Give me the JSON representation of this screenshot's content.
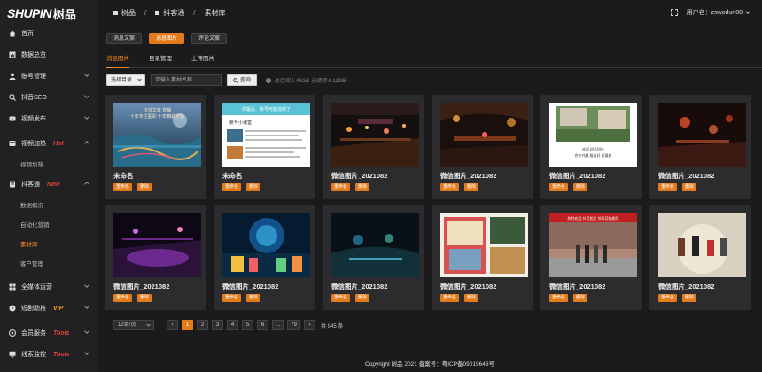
{
  "logo": {
    "en": "SHUPIN",
    "cn": "树品"
  },
  "sidebar": {
    "items": [
      {
        "label": "首页",
        "icon": "home-icon"
      },
      {
        "label": "数据总览",
        "icon": "chart-icon"
      },
      {
        "label": "账号管理",
        "icon": "user-icon"
      },
      {
        "label": "抖音SEO",
        "icon": "seo-icon"
      },
      {
        "label": "视频发布",
        "icon": "video-icon"
      },
      {
        "label": "视频加热",
        "icon": "fire-icon",
        "tag": "Hot"
      },
      {
        "label": "视频加热",
        "sub": true
      },
      {
        "label": "抖客通",
        "icon": "doc-icon",
        "tag": "New"
      },
      {
        "label": "数据概况",
        "sub": true
      },
      {
        "label": "自动化营销",
        "sub": true
      },
      {
        "label": "素材库",
        "sub": true,
        "active": true
      },
      {
        "label": "客户管理",
        "sub": true
      },
      {
        "label": "全媒体运营",
        "icon": "media-icon"
      },
      {
        "label": "短剧助推",
        "icon": "play-icon",
        "tag": "VIP"
      },
      {
        "label": "会员服务",
        "icon": "member-icon",
        "tag": "Tools"
      },
      {
        "label": "线索监控",
        "icon": "monitor-icon",
        "tag": "Tools"
      }
    ]
  },
  "header": {
    "breadcrumb": [
      "树品",
      "抖客通",
      "素材库"
    ],
    "username": "用户名：zswodun88"
  },
  "main": {
    "type_buttons": [
      {
        "label": "消息文案",
        "active": false
      },
      {
        "label": "消息图片",
        "active": true
      },
      {
        "label": "评论文案",
        "active": false
      }
    ],
    "tabs": [
      {
        "label": "消息图片",
        "active": true
      },
      {
        "label": "目录管理",
        "active": false
      },
      {
        "label": "上传图片",
        "active": false
      }
    ],
    "filter": {
      "select_label": "选择目录",
      "search_placeholder": "请输入素材名称",
      "search_button": "查询",
      "quota": "总空间 1.46GB 已使用 0.11GB"
    },
    "cards": [
      {
        "name": "未命名",
        "rename": "重命名",
        "delete": "删除"
      },
      {
        "name": "未命名",
        "rename": "重命名",
        "delete": "删除"
      },
      {
        "name": "微信图片_2021082",
        "rename": "重命名",
        "delete": "删除"
      },
      {
        "name": "微信图片_2021082",
        "rename": "重命名",
        "delete": "删除"
      },
      {
        "name": "微信图片_2021082",
        "rename": "重命名",
        "delete": "删除"
      },
      {
        "name": "微信图片_2021082",
        "rename": "重命名",
        "delete": "删除"
      },
      {
        "name": "微信图片_2021082",
        "rename": "重命名",
        "delete": "删除"
      },
      {
        "name": "微信图片_2021082",
        "rename": "重命名",
        "delete": "删除"
      },
      {
        "name": "微信图片_2021082",
        "rename": "重命名",
        "delete": "删除"
      },
      {
        "name": "微信图片_2021082",
        "rename": "重命名",
        "delete": "删除"
      },
      {
        "name": "微信图片_2021082",
        "rename": "重命名",
        "delete": "删除"
      },
      {
        "name": "微信图片_2021082",
        "rename": "重命名",
        "delete": "删除"
      }
    ],
    "thumb_text": {
      "card1_line1": "抖音文旅 直播",
      "card1_line2": "十年专注图彩 十年精耕开始",
      "card2_header": "你最近、账号可能违规了",
      "card2_title": "账号小课堂",
      "card6_caption1": "欢迎 树品科技",
      "card6_caption2": "合作共赢 服务好 质量好",
      "card11_banner": "热烈欢迎 抖音相关 领导莅临指导"
    },
    "pager": {
      "page_size": "12条/页",
      "pages": [
        "‹",
        "1",
        "2",
        "3",
        "4",
        "5",
        "6",
        "…",
        "79",
        "›"
      ],
      "active_page": "1",
      "total": "共 945 条"
    }
  },
  "footer": {
    "text": "Copyright 树品 2021 备案号：粤ICP备09019646号"
  },
  "colors": {
    "accent": "#e37b1a",
    "bg": "#1b1b1d",
    "sidebar": "#212124",
    "card": "#2c2c2f",
    "hot": "#e5433a",
    "vip": "#f0a020"
  }
}
